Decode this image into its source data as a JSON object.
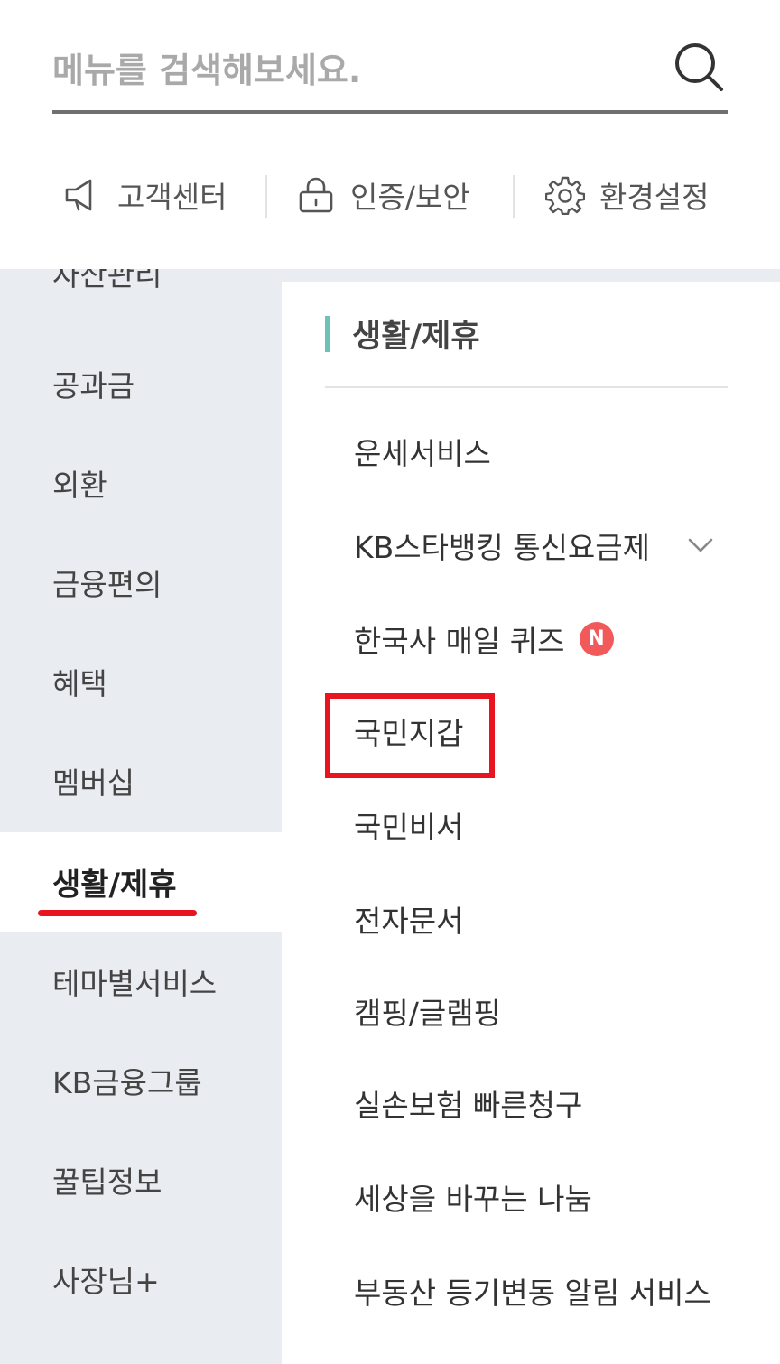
{
  "search": {
    "placeholder": "메뉴를 검색해보세요."
  },
  "quick_links": [
    {
      "label": "고객센터",
      "icon": "megaphone-icon"
    },
    {
      "label": "인증/보안",
      "icon": "lock-icon"
    },
    {
      "label": "환경설정",
      "icon": "gear-icon"
    }
  ],
  "left_menu": {
    "cut_item": "자산관리",
    "items": [
      "공과금",
      "외환",
      "금융편의",
      "혜택",
      "멤버십",
      "생활/제휴",
      "테마별서비스",
      "KB금융그룹",
      "꿀팁정보",
      "사장님+"
    ],
    "active": "생활/제휴"
  },
  "section": {
    "title": "생활/제휴",
    "items": [
      "운세서비스",
      "KB스타뱅킹 통신요금제",
      "한국사 매일 퀴즈",
      "국민지갑",
      "국민비서",
      "전자문서",
      "캠핑/글램핑",
      "실손보험 빠른청구",
      "세상을 바꾸는 나눔",
      "부동산 등기변동 알림 서비스"
    ],
    "new_badge": "N"
  },
  "colors": {
    "accent_red": "#e8141f",
    "section_bar": "#6cc2b4",
    "left_bg": "#e9edf1",
    "badge": "#f2595a"
  }
}
